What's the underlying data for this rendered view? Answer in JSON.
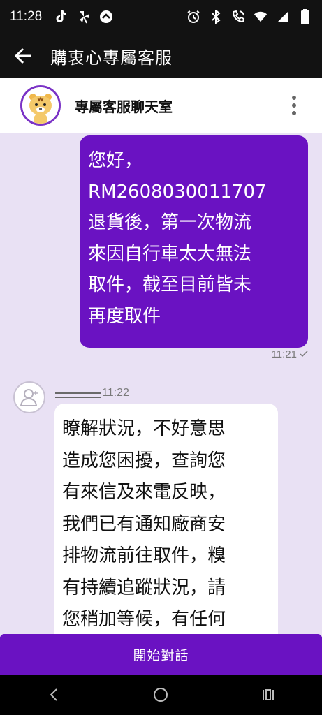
{
  "status_bar": {
    "time": "11:28",
    "left_icons": [
      "tiktok-icon",
      "pinwheel-icon",
      "upload-arrow-icon"
    ],
    "right_icons": [
      "alarm-icon",
      "bluetooth-icon",
      "wifi-calling-icon",
      "wifi-icon",
      "signal-icon",
      "battery-icon"
    ]
  },
  "app_bar": {
    "title": "購衷心專屬客服",
    "back_icon": "arrow-left-icon"
  },
  "chat_header": {
    "name": "專屬客服聊天室",
    "avatar": "tiger-mascot-avatar",
    "menu_icon": "more-vert-icon"
  },
  "messages": [
    {
      "direction": "outgoing",
      "text": "您好，\nRM2608030011707\n退貨後，第一次物流\n來因自行車太大無法\n取件，截至目前皆未\n再度取件",
      "time": "11:21",
      "status_icon": "check-icon"
    },
    {
      "direction": "incoming",
      "time": "11:22",
      "avatar": "person-placeholder-icon",
      "text": "瞭解狀況，不好意思\n造成您困擾，查詢您\n有來信及來電反映，\n我們已有通知廠商安\n排物流前往取件，糗\n有持續追蹤狀況，請\n您稍加等候，有任何"
    }
  ],
  "start_button": {
    "label": "開始對話"
  },
  "nav_bar": {
    "icons": [
      "back-chevron-icon",
      "home-circle-icon",
      "recents-icon"
    ]
  },
  "colors": {
    "accent": "#6a12c2",
    "chat_bg": "#e9e1f4",
    "bar_bg": "#121212"
  }
}
